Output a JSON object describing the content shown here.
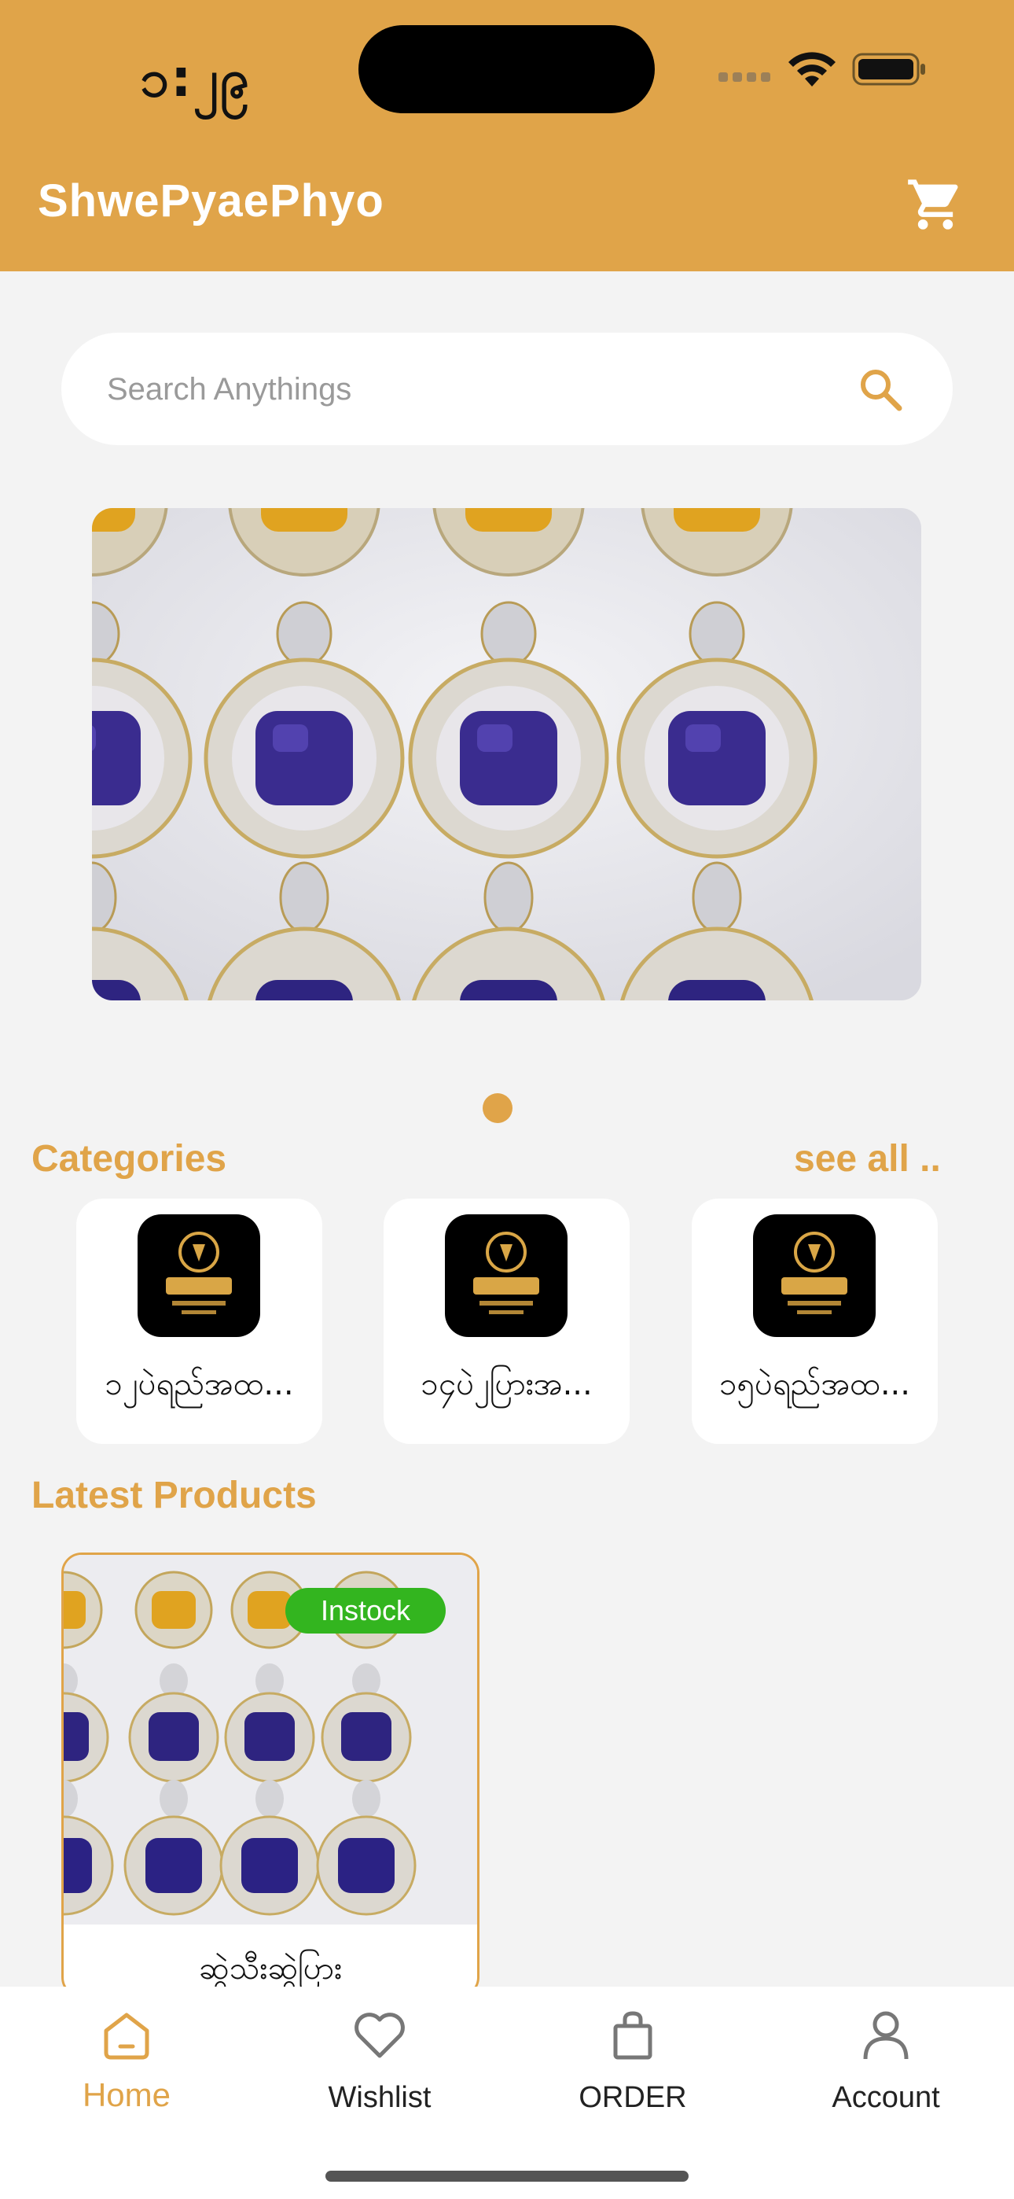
{
  "status_bar": {
    "time": "၁:၂၉"
  },
  "header": {
    "title": "ShwePyaePhyo",
    "cart_icon": "cart-icon"
  },
  "search": {
    "placeholder": "Search Anythings"
  },
  "banner": {
    "image": "jewelry-pendants-photo",
    "page_count": 1,
    "active_page": 1
  },
  "categories": {
    "title": "Categories",
    "see_all": "see all ..",
    "items": [
      {
        "label": "၁၂ပဲရည်အထ...",
        "logo": "shop-logo"
      },
      {
        "label": "၁၄ပဲ၂ပြားအ...",
        "logo": "shop-logo"
      },
      {
        "label": "၁၅ပဲရည်အထ...",
        "logo": "shop-logo"
      }
    ]
  },
  "latest_products": {
    "title": "Latest Products",
    "items": [
      {
        "badge": "Instock",
        "name": "ဆွဲသီးဆွဲပြား"
      }
    ]
  },
  "bottom_nav": {
    "items": [
      {
        "label": "Home",
        "icon": "home-icon",
        "active": true
      },
      {
        "label": "Wishlist",
        "icon": "heart-icon",
        "active": false
      },
      {
        "label": "ORDER",
        "icon": "shopping-bag-icon",
        "active": false
      },
      {
        "label": "Account",
        "icon": "user-icon",
        "active": false
      }
    ]
  },
  "colors": {
    "accent": "#e0a449",
    "badge": "#33b51f",
    "background": "#f3f3f3"
  }
}
